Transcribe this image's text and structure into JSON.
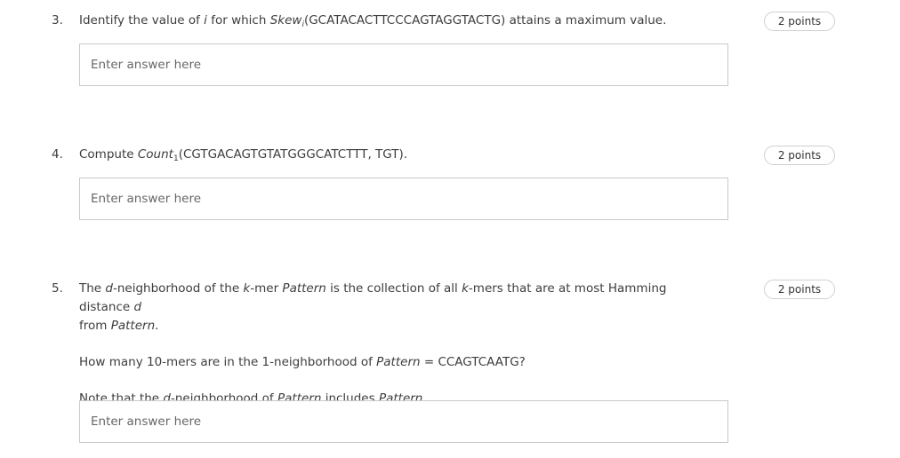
{
  "questions": [
    {
      "number": "3.",
      "points": "2 points",
      "text": {
        "p1": "Identify the value of ",
        "i_var": "i",
        "p2": " for which ",
        "skew": "Skew",
        "skew_sub": "i",
        "p3": "(GCATACACTTCCCAGTAGGTACTG) attains a maximum value."
      },
      "answer": {
        "placeholder": "Enter answer here",
        "value": ""
      }
    },
    {
      "number": "4.",
      "points": "2 points",
      "text": {
        "count": "Count",
        "count_sub": "1",
        "p0": "Compute ",
        "p1": "(CGTGACAGTGTATGGGCATCTTT, TGT)."
      },
      "answer": {
        "placeholder": "Enter answer here",
        "value": ""
      }
    },
    {
      "number": "5.",
      "points": "2 points",
      "text": {
        "l1a": "The ",
        "d1": "d",
        "l1b": "-neighborhood of the ",
        "k1": "k",
        "l1c": "-mer ",
        "pattern1": "Pattern",
        "l1d": " is the collection of all ",
        "k2": "k",
        "l1e": "-mers that are at most Hamming distance ",
        "d2": "d",
        "l2a": "from ",
        "pattern2": "Pattern",
        "l2b": ".",
        "para2a": "How many 10-mers are in the 1-neighborhood of ",
        "pattern3": "Pattern",
        "para2b": " = CCAGTCAATG?",
        "para3a": "Note that the ",
        "d3": "d",
        "para3b": "-neighborhood of ",
        "pattern4": "Pattern",
        "para3c": " includes ",
        "pattern5": "Pattern",
        "para3d": "."
      },
      "answer": {
        "placeholder": "Enter answer here",
        "value": ""
      }
    }
  ]
}
